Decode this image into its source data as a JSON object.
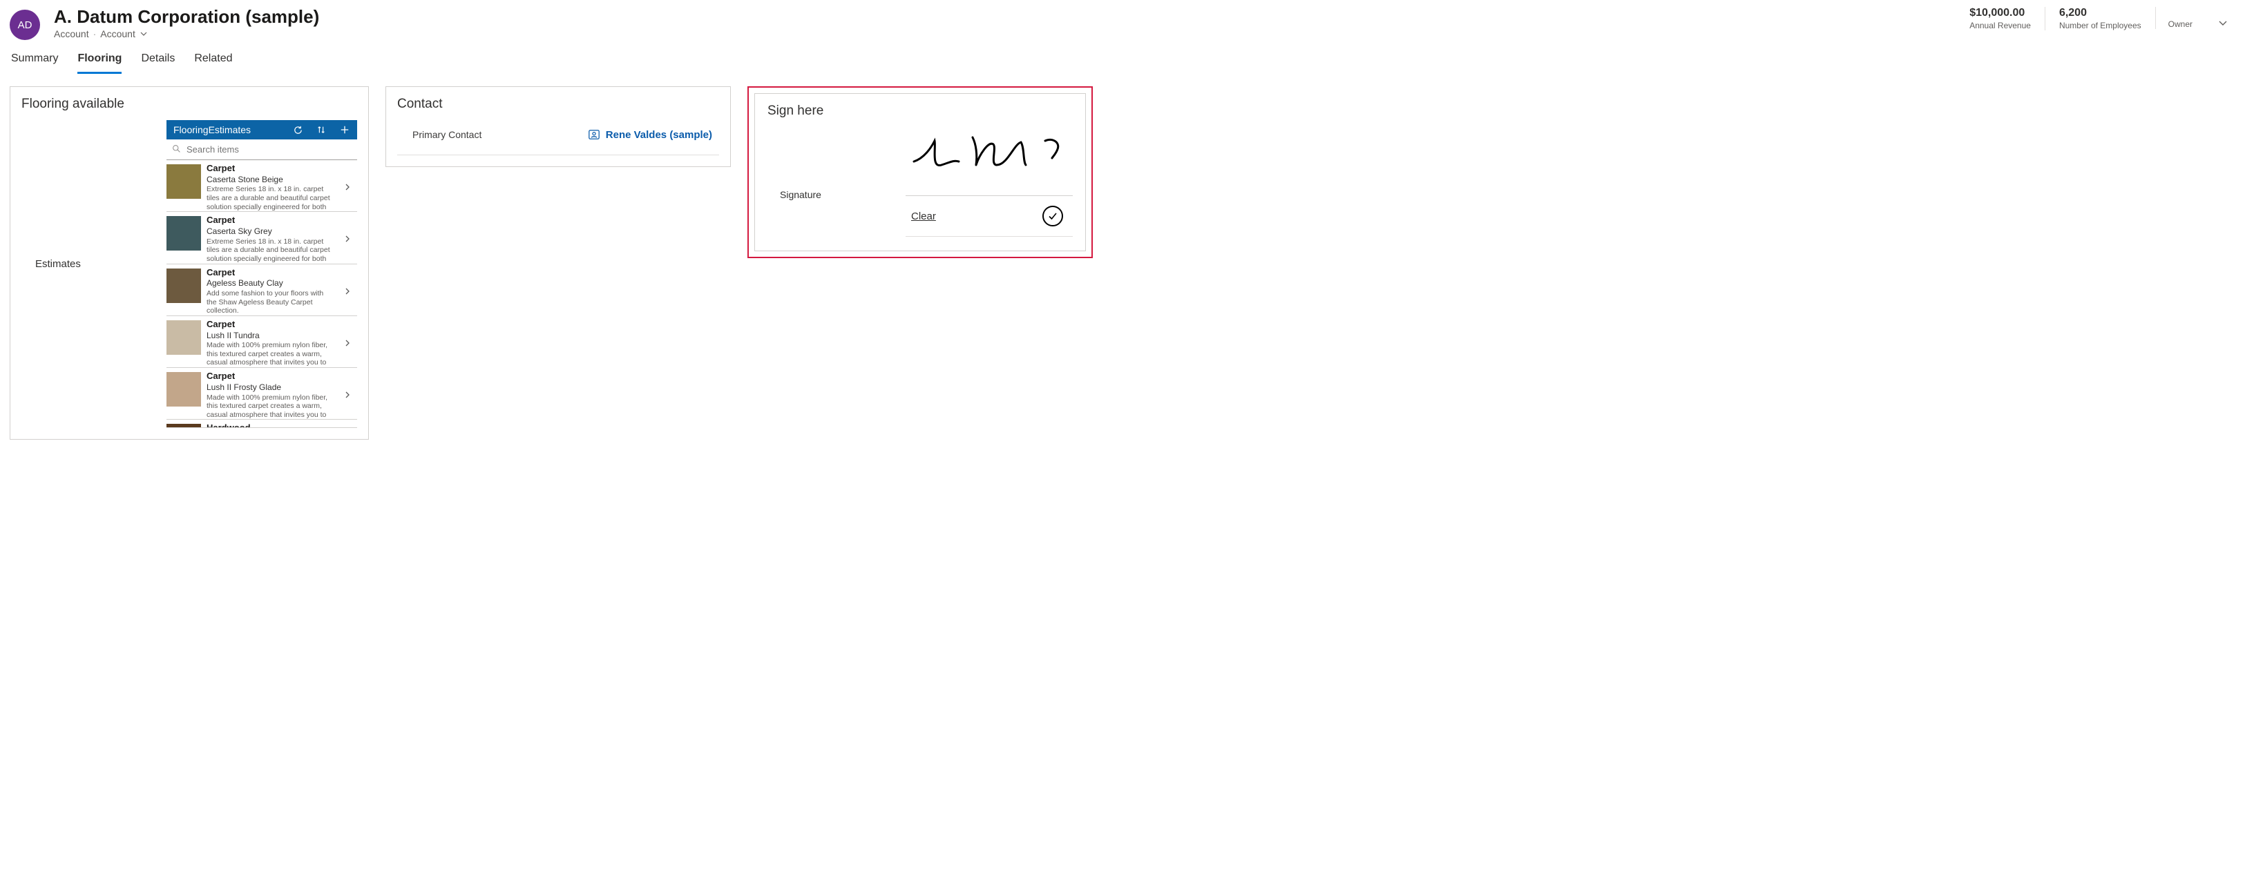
{
  "header": {
    "avatar_initials": "AD",
    "title": "A. Datum Corporation (sample)",
    "entity_type": "Account",
    "form_type": "Account"
  },
  "metrics": {
    "revenue_value": "$10,000.00",
    "revenue_label": "Annual Revenue",
    "employees_value": "6,200",
    "employees_label": "Number of Employees",
    "owner_label": "Owner"
  },
  "tabs": [
    "Summary",
    "Flooring",
    "Details",
    "Related"
  ],
  "active_tab_index": 1,
  "flooring": {
    "card_title": "Flooring available",
    "section_label": "Estimates",
    "gallery_title": "FlooringEstimates",
    "search_placeholder": "Search items",
    "items": [
      {
        "type": "Carpet",
        "name": "Caserta Stone Beige",
        "desc": "Extreme Series 18 in. x 18 in. carpet tiles are a durable and beautiful carpet solution specially engineered for both"
      },
      {
        "type": "Carpet",
        "name": "Caserta Sky Grey",
        "desc": "Extreme Series 18 in. x 18 in. carpet tiles are a durable and beautiful carpet solution specially engineered for both"
      },
      {
        "type": "Carpet",
        "name": "Ageless Beauty Clay",
        "desc": "Add some fashion to your floors with the Shaw Ageless Beauty Carpet collection."
      },
      {
        "type": "Carpet",
        "name": "Lush II Tundra",
        "desc": "Made with 100% premium nylon fiber, this textured carpet creates a warm, casual atmosphere that invites you to"
      },
      {
        "type": "Carpet",
        "name": "Lush II Frosty Glade",
        "desc": "Made with 100% premium nylon fiber, this textured carpet creates a warm, casual atmosphere that invites you to"
      },
      {
        "type": "Hardwood",
        "name": "",
        "desc": ""
      }
    ]
  },
  "contact": {
    "card_title": "Contact",
    "field_label": "Primary Contact",
    "value": "Rene Valdes (sample)"
  },
  "signature": {
    "card_title": "Sign here",
    "field_label": "Signature",
    "clear_label": "Clear"
  }
}
